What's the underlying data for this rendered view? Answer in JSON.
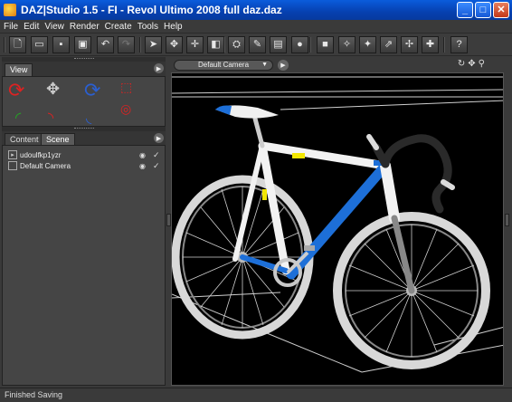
{
  "window": {
    "title": "DAZ|Studio 1.5  -  FI - Revol Ultimo 2008 full daz.daz"
  },
  "menu": {
    "items": [
      "File",
      "Edit",
      "View",
      "Render",
      "Create",
      "Tools",
      "Help"
    ]
  },
  "toolbar": {
    "icons": [
      "new-file-icon",
      "open-folder-icon",
      "save-icon",
      "save-as-icon",
      "undo-icon",
      "redo-icon",
      "select-arrow-icon",
      "rotate-icon",
      "translate-icon",
      "scale-icon",
      "node-select-icon",
      "render-icon",
      "render-settings-icon",
      "sphere-icon",
      "add-node-icon",
      "spotlight-icon",
      "pointlight-icon",
      "distant-light-icon",
      "camera-add-icon",
      "figure-add-icon",
      "help-icon"
    ]
  },
  "view_pane": {
    "tab_label": "View"
  },
  "scene_pane": {
    "tabs": [
      "Content",
      "Scene"
    ],
    "active_tab": "Scene",
    "items": [
      {
        "name": "udoulfkp1yzr"
      },
      {
        "name": "Default Camera"
      }
    ]
  },
  "viewport": {
    "camera": "Default Camera"
  },
  "status": {
    "message": "Finished Saving"
  },
  "colors": {
    "title_bar": "#0a5cdc",
    "frame_blue": "#1d6fd8",
    "background": "#000000"
  }
}
